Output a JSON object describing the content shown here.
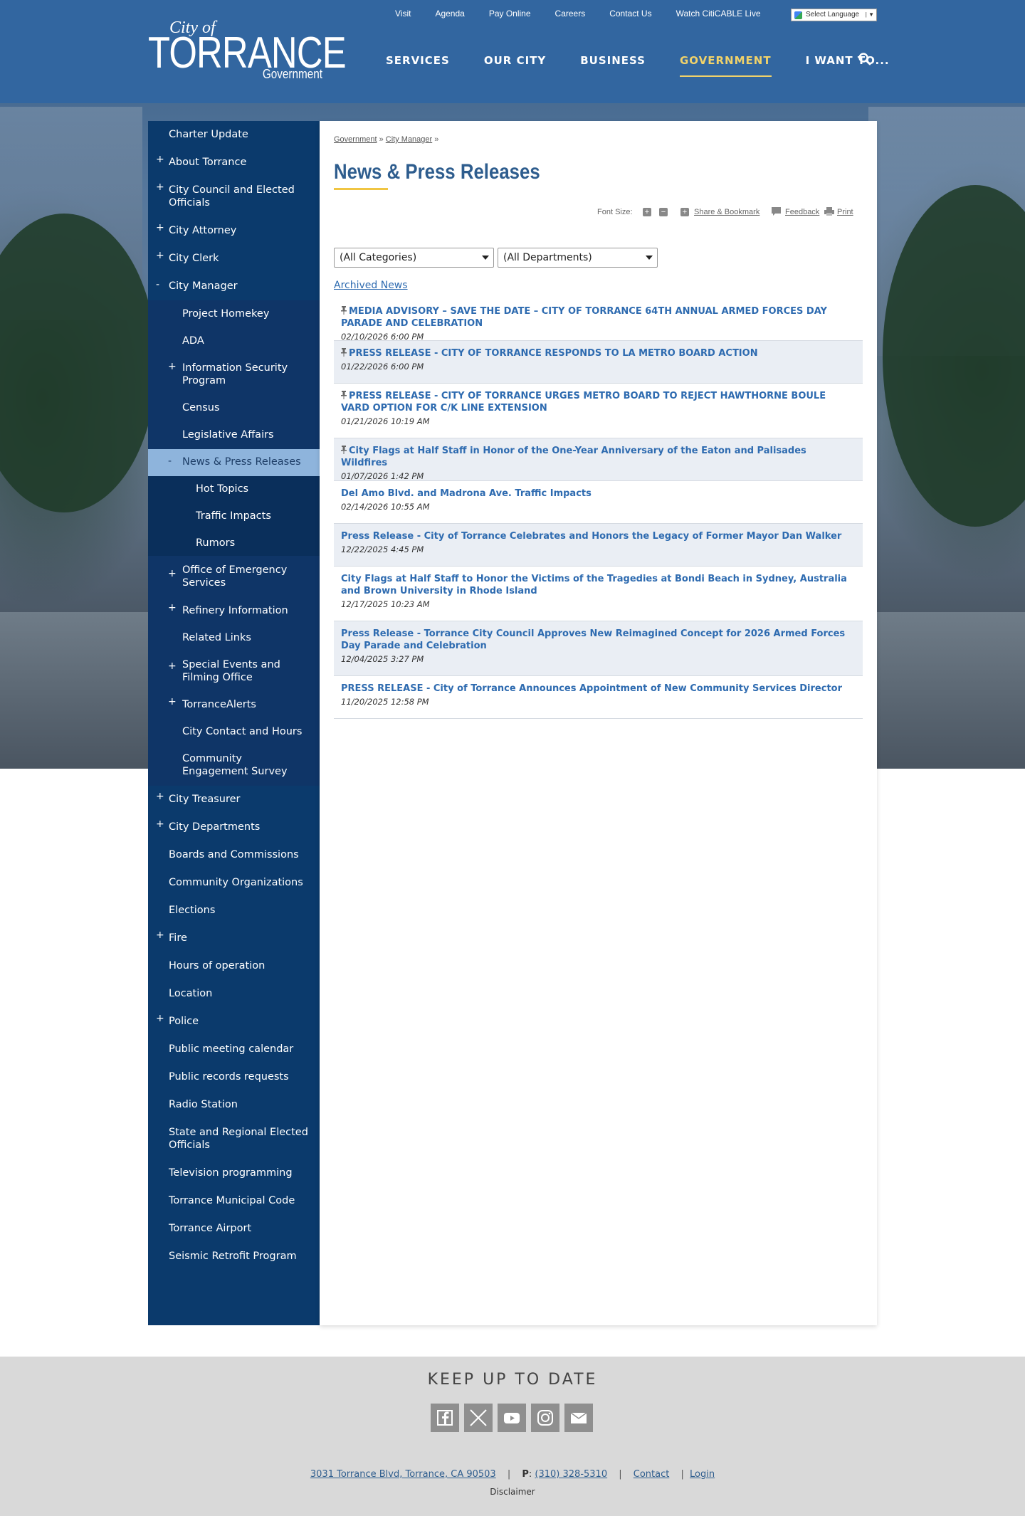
{
  "header": {
    "logo": {
      "city_of": "City of",
      "name": "TORRANCE",
      "sub": "Government"
    },
    "utility_nav": [
      "Visit",
      "Agenda",
      "Pay Online",
      "Careers",
      "Contact Us",
      "Watch CitiCABLE Live"
    ],
    "language_select": "Select Language",
    "main_nav": [
      "SERVICES",
      "OUR CITY",
      "BUSINESS",
      "GOVERNMENT",
      "I WANT TO..."
    ],
    "active_nav": "GOVERNMENT",
    "accent_color": "#f0d26a",
    "header_color": "#3266a0"
  },
  "sidebar": {
    "items": [
      {
        "label": "Charter Update",
        "expander": ""
      },
      {
        "label": "About Torrance",
        "expander": "+"
      },
      {
        "label": "City Council and Elected Officials",
        "expander": "+"
      },
      {
        "label": "City Attorney",
        "expander": "+"
      },
      {
        "label": "City Clerk",
        "expander": "+"
      },
      {
        "label": "City Manager",
        "expander": "-"
      },
      {
        "label": "Project Homekey",
        "expander": ""
      },
      {
        "label": "ADA",
        "expander": ""
      },
      {
        "label": "Information Security Program",
        "expander": "+"
      },
      {
        "label": "Census",
        "expander": ""
      },
      {
        "label": "Legislative Affairs",
        "expander": ""
      },
      {
        "label": "News & Press Releases",
        "expander": "-"
      },
      {
        "label": "Hot Topics",
        "expander": ""
      },
      {
        "label": "Traffic Impacts",
        "expander": ""
      },
      {
        "label": "Rumors",
        "expander": ""
      },
      {
        "label": "Office of Emergency Services",
        "expander": "+"
      },
      {
        "label": "Refinery Information",
        "expander": "+"
      },
      {
        "label": "Related Links",
        "expander": ""
      },
      {
        "label": "Special Events and Filming Office",
        "expander": "+"
      },
      {
        "label": "TorranceAlerts",
        "expander": "+"
      },
      {
        "label": "City Contact and Hours",
        "expander": ""
      },
      {
        "label": "Community Engagement Survey",
        "expander": ""
      },
      {
        "label": "City Treasurer",
        "expander": "+"
      },
      {
        "label": "City Departments",
        "expander": "+"
      },
      {
        "label": "Boards and Commissions",
        "expander": ""
      },
      {
        "label": "Community Organizations",
        "expander": ""
      },
      {
        "label": "Elections",
        "expander": ""
      },
      {
        "label": "Fire",
        "expander": "+"
      },
      {
        "label": "Hours of operation",
        "expander": ""
      },
      {
        "label": "Location",
        "expander": ""
      },
      {
        "label": "Police",
        "expander": "+"
      },
      {
        "label": "Public meeting calendar",
        "expander": ""
      },
      {
        "label": "Public records requests",
        "expander": ""
      },
      {
        "label": "Radio Station",
        "expander": ""
      },
      {
        "label": "State and Regional Elected Officials",
        "expander": ""
      },
      {
        "label": "Television programming",
        "expander": ""
      },
      {
        "label": "Torrance Municipal Code",
        "expander": ""
      },
      {
        "label": "Torrance Airport",
        "expander": ""
      },
      {
        "label": "Seismic Retrofit Program",
        "expander": ""
      }
    ]
  },
  "content": {
    "breadcrumb": [
      "Government",
      "City Manager"
    ],
    "breadcrumb_sep": "»",
    "title": "News & Press Releases",
    "tools": {
      "font_size": "Font Size:",
      "share": "Share & Bookmark",
      "feedback": "Feedback",
      "print": "Print"
    },
    "filters": {
      "categories": "(All Categories)",
      "departments": "(All Departments)"
    },
    "archived_link": "Archived News",
    "news": [
      {
        "title": "MEDIA ADVISORY – SAVE THE DATE – CITY OF TORRANCE 64TH ANNUAL ARMED FORCES DAY PARADE AND CELEBRATION",
        "date": "02/10/2026 6:00 PM",
        "pinned": true
      },
      {
        "title": "PRESS RELEASE - CITY OF TORRANCE RESPONDS TO LA METRO BOARD ACTION",
        "date": "01/22/2026 6:00 PM",
        "pinned": true
      },
      {
        "title": "PRESS RELEASE - CITY OF TORRANCE URGES METRO BOARD TO REJECT HAWTHORNE BOULE VARD OPTION FOR C/K LINE EXTENSION",
        "date": "01/21/2026 10:19 AM",
        "pinned": true
      },
      {
        "title": "City Flags at Half Staff in Honor of the One-Year Anniversary of the Eaton and Palisades Wildfires",
        "date": "01/07/2026 1:42 PM",
        "pinned": true
      },
      {
        "title": "Del Amo Blvd. and Madrona Ave. Traffic Impacts",
        "date": "02/14/2026 10:55 AM",
        "pinned": false
      },
      {
        "title": "Press Release - City of Torrance Celebrates and Honors the Legacy of Former Mayor Dan Walker",
        "date": "12/22/2025 4:45 PM",
        "pinned": false
      },
      {
        "title": "City Flags at Half Staff to Honor the Victims of the Tragedies at Bondi Beach in Sydney, Australia and Brown University in Rhode Island",
        "date": "12/17/2025 10:23 AM",
        "pinned": false
      },
      {
        "title": "Press Release - Torrance City Council Approves New Reimagined Concept for 2026 Armed Forces Day Parade and Celebration",
        "date": "12/04/2025 3:27 PM",
        "pinned": false
      },
      {
        "title": "PRESS RELEASE - City of Torrance Announces Appointment of New Community Services Director",
        "date": "11/20/2025 12:58 PM",
        "pinned": false
      }
    ]
  },
  "footer": {
    "title": "KEEP UP TO DATE",
    "social": [
      "facebook-icon",
      "x-icon",
      "youtube-icon",
      "instagram-icon",
      "email-icon"
    ],
    "address": "3031 Torrance Blvd, Torrance, CA 90503",
    "phone_label": "P",
    "phone": "(310) 328-5310",
    "contact": "Contact",
    "login": "Login",
    "disclaimer": "Disclaimer"
  }
}
